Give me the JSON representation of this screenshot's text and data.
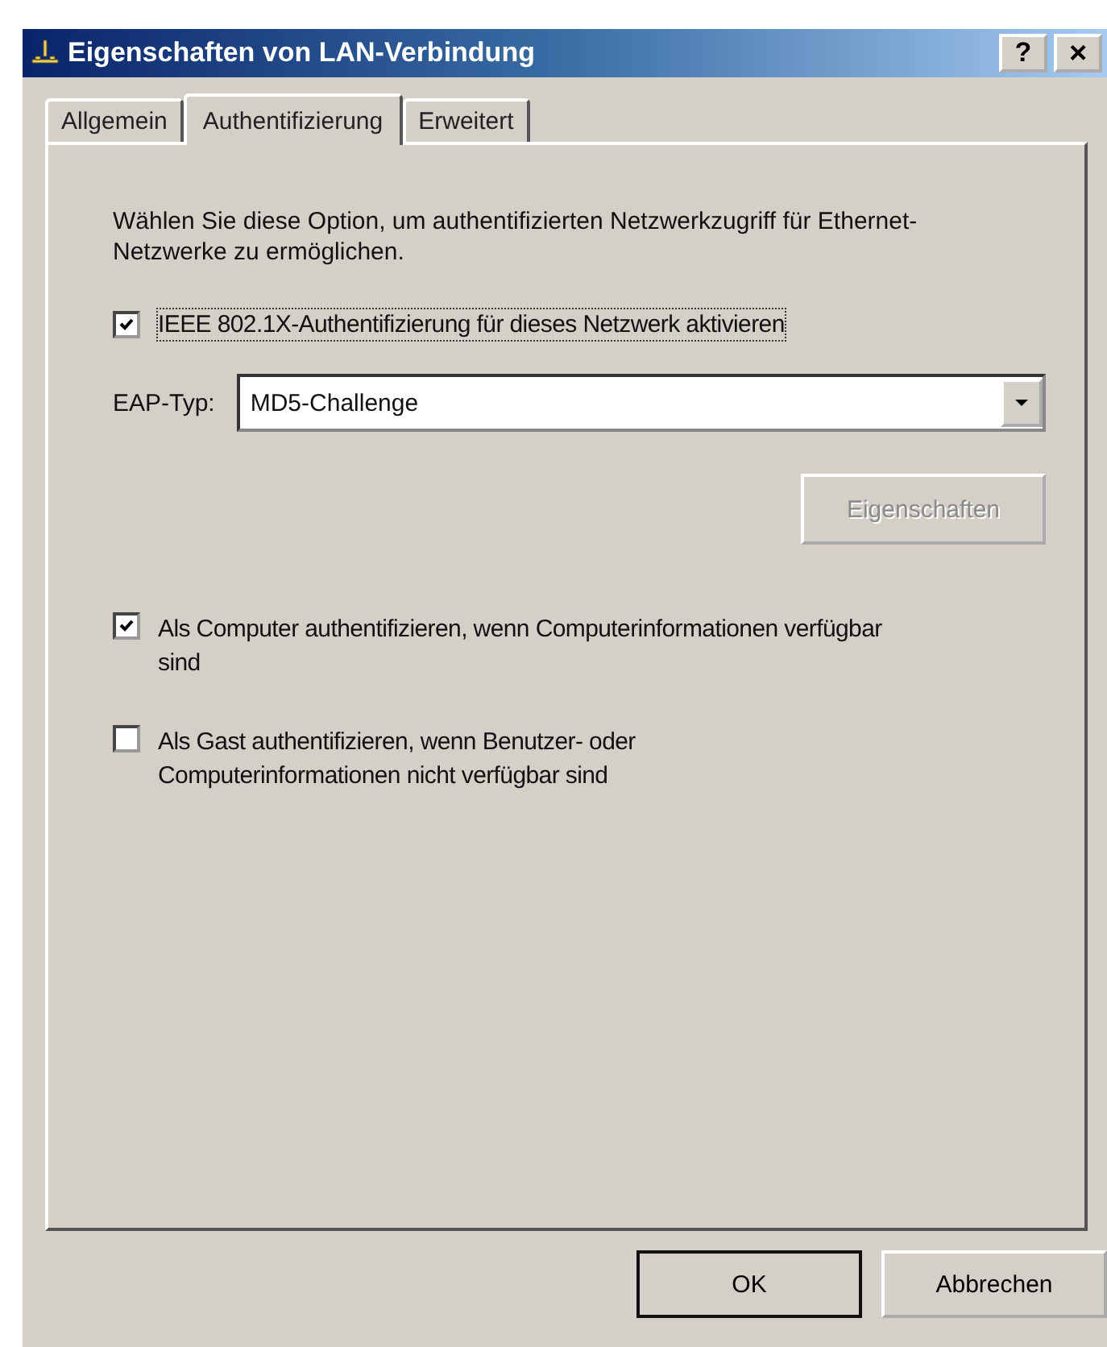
{
  "window": {
    "title": "Eigenschaften von LAN-Verbindung",
    "buttons": [
      {
        "kind": "help",
        "label": "?"
      },
      {
        "kind": "close",
        "label": "×"
      }
    ]
  },
  "tabs": [
    {
      "label": "Allgemein",
      "selected": false
    },
    {
      "label": "Authentifizierung",
      "selected": true
    },
    {
      "label": "Erweitert",
      "selected": false
    }
  ],
  "description": "Wählen Sie diese Option, um authentifizierten Netzwerkzugriff für Ethernet-Netzwerke zu ermöglichen.",
  "enable_checkbox": {
    "label": "IEEE 802.1X-Authentifizierung für dieses Netzwerk aktivieren",
    "checked": true,
    "focused": true
  },
  "eap_type": {
    "label": "EAP-Typ:",
    "value": "MD5-Challenge"
  },
  "properties_button": {
    "label": "Eigenschaften",
    "disabled": true
  },
  "options": [
    {
      "label": "Als Computer authentifizieren, wenn Computerinformationen verfügbar sind",
      "checked": true
    },
    {
      "label": "Als Gast authentifizieren, wenn Benutzer- oder Computerinformationen nicht verfügbar sind",
      "checked": false
    }
  ],
  "buttons": [
    {
      "label": "OK",
      "default": true
    },
    {
      "label": "Abbrechen",
      "default": false
    }
  ]
}
